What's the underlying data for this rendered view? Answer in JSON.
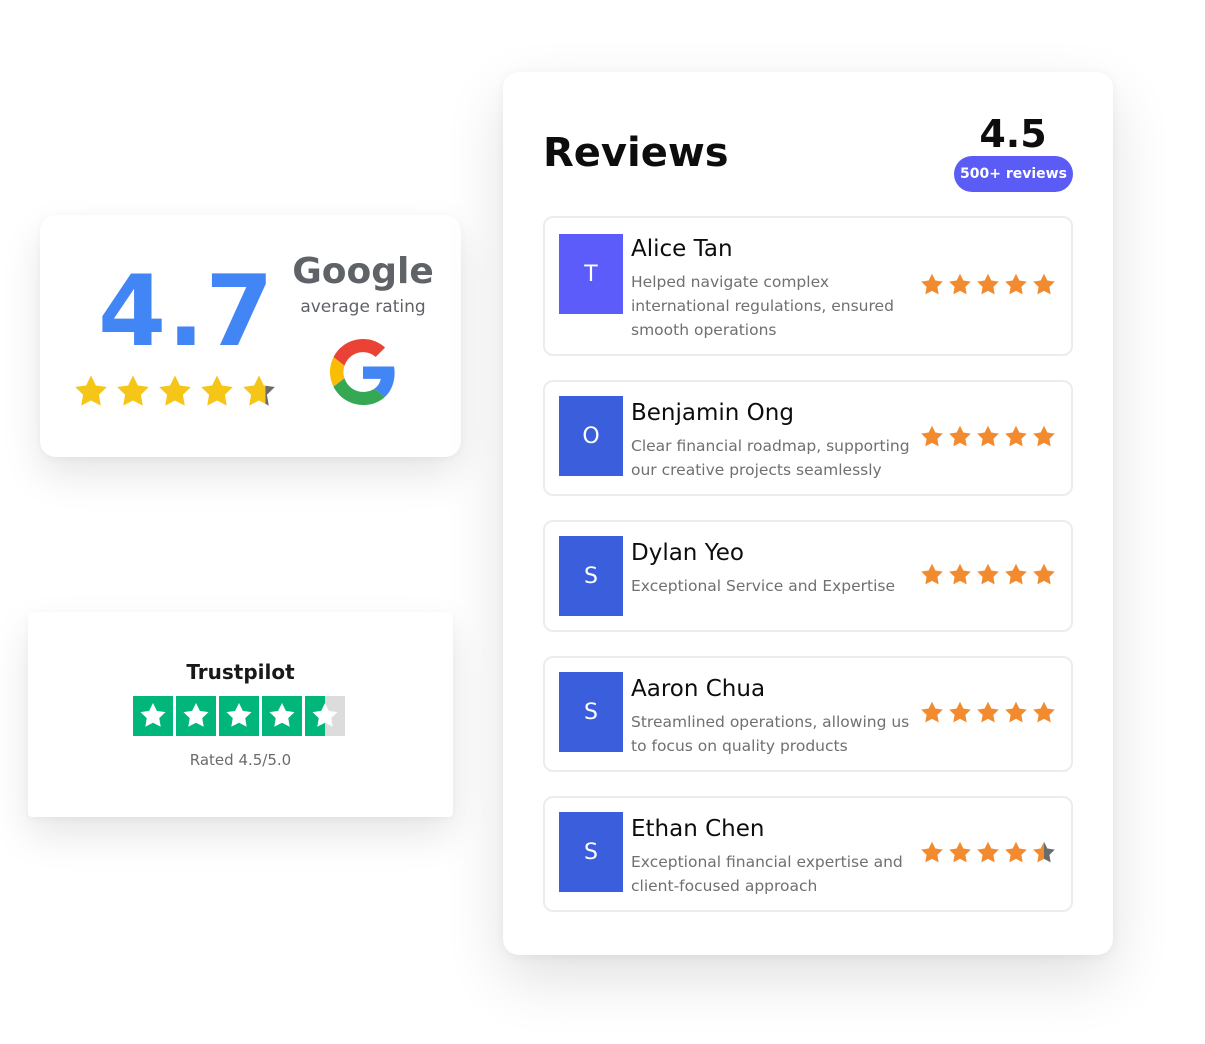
{
  "google": {
    "score": "4.7",
    "rating": 4.7,
    "brand": "Google",
    "subtitle": "average rating",
    "star_color": "#F5C518",
    "empty_color": "#6b6b6b",
    "score_color": "#4285F4",
    "logo_icon": "google-g-icon"
  },
  "trustpilot": {
    "name": "Trustpilot",
    "rating": 4.5,
    "rated_text": "Rated 4.5/5.0",
    "green": "#00b67a",
    "empty_color": "#dcdcdc"
  },
  "reviews": {
    "title": "Reviews",
    "overall": "4.5",
    "count_label": "500+ reviews",
    "badge_color": "#5a5cf5",
    "star_color": "#F28B30",
    "empty_color": "#6b6b6b",
    "items": [
      {
        "initial": "T",
        "name": "Alice Tan",
        "text": "Helped navigate complex international regulations, ensured smooth operations",
        "rating": 5,
        "avatar_color": "#5c5cfb"
      },
      {
        "initial": "O",
        "name": "Benjamin Ong",
        "text": "Clear financial roadmap, supporting our creative projects seamlessly",
        "rating": 5,
        "avatar_color": "#3b5fdc"
      },
      {
        "initial": "S",
        "name": "Dylan Yeo",
        "text": "Exceptional Service and Expertise",
        "rating": 5,
        "avatar_color": "#3b5fdc"
      },
      {
        "initial": "S",
        "name": "Aaron Chua",
        "text": "Streamlined operations, allowing us to focus on quality products",
        "rating": 5,
        "avatar_color": "#3b5fdc"
      },
      {
        "initial": "S",
        "name": "Ethan Chen",
        "text": "Exceptional financial expertise and client-focused approach",
        "rating": 4.5,
        "avatar_color": "#3b5fdc"
      }
    ]
  }
}
